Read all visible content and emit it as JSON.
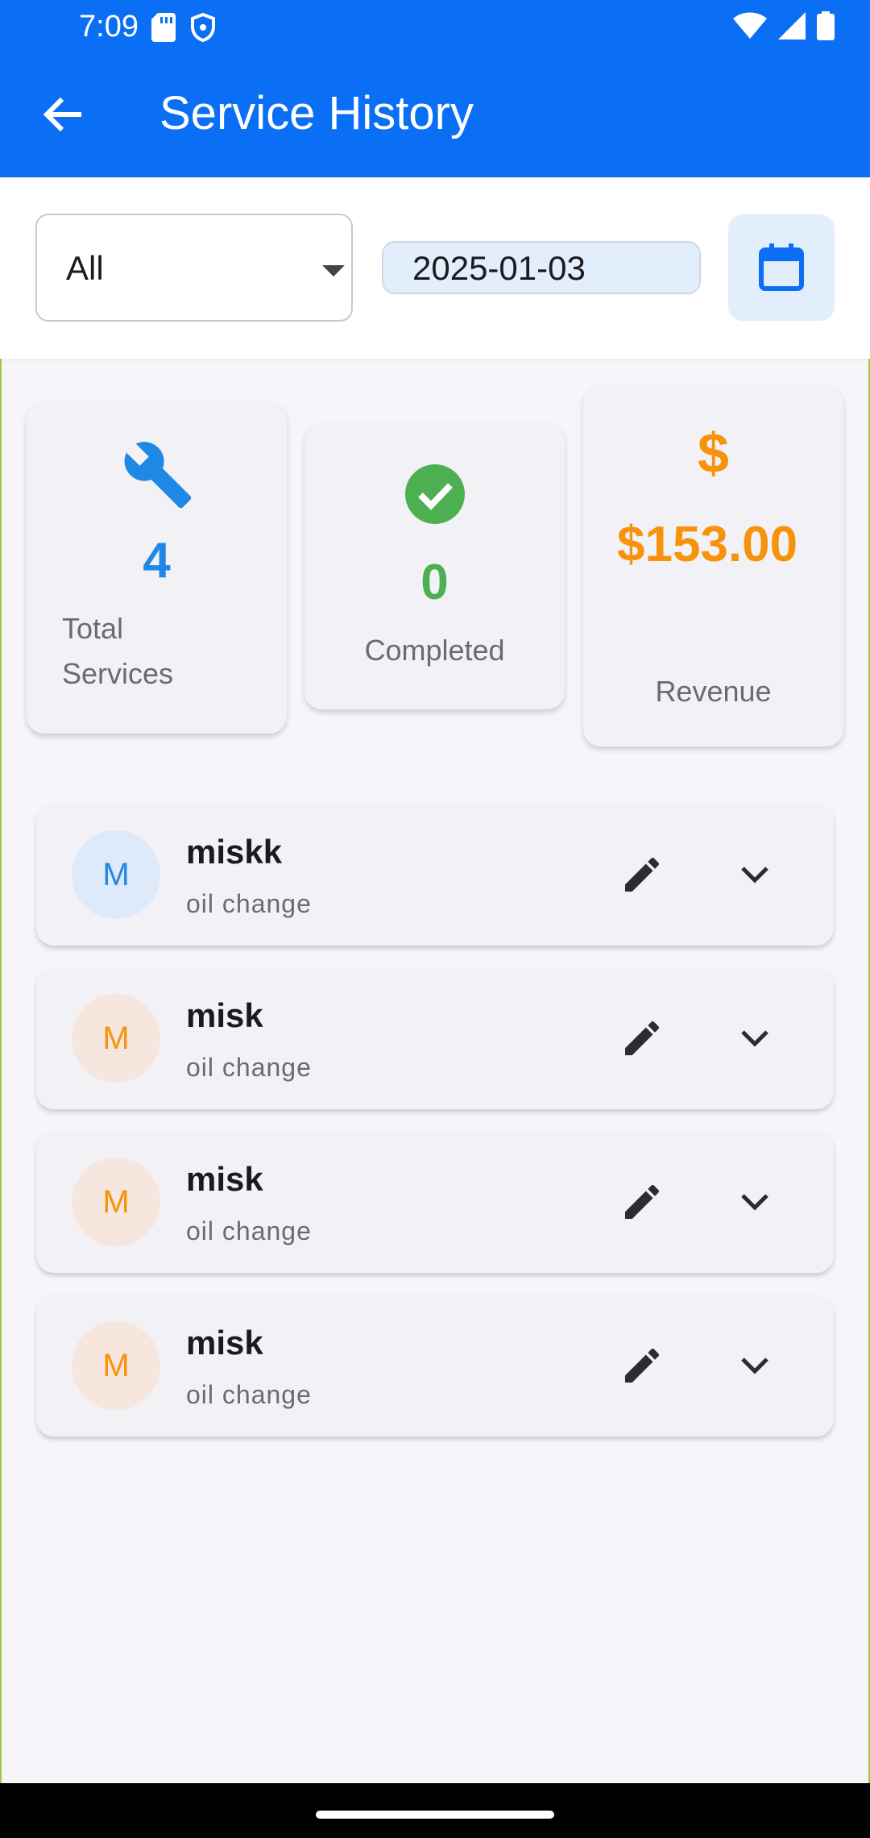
{
  "status_bar": {
    "time": "7:09"
  },
  "app_bar": {
    "title": "Service History"
  },
  "filters": {
    "status_selected": "All",
    "date": "2025-01-03"
  },
  "stats": [
    {
      "value": "4",
      "label": "Total Services",
      "icon": "wrench-icon",
      "color": "#1f88e5"
    },
    {
      "value": "0",
      "label": "Completed",
      "icon": "check-circle-icon",
      "color": "#4caf50"
    },
    {
      "value": "$153.00",
      "label": "Revenue",
      "icon": "dollar-icon",
      "color": "#f7930a"
    }
  ],
  "services": [
    {
      "initial": "M",
      "name": "miskk",
      "service": "oil change",
      "avatar_color": "#1f88e5",
      "avatar_bg": "#dee9f9"
    },
    {
      "initial": "M",
      "name": "misk",
      "service": "oil change",
      "avatar_color": "#f7930a",
      "avatar_bg": "#f6e6dd"
    },
    {
      "initial": "M",
      "name": "misk",
      "service": "oil change",
      "avatar_color": "#f7930a",
      "avatar_bg": "#f6e6dd"
    },
    {
      "initial": "M",
      "name": "misk",
      "service": "oil change",
      "avatar_color": "#f7930a",
      "avatar_bg": "#f6e6dd"
    }
  ]
}
